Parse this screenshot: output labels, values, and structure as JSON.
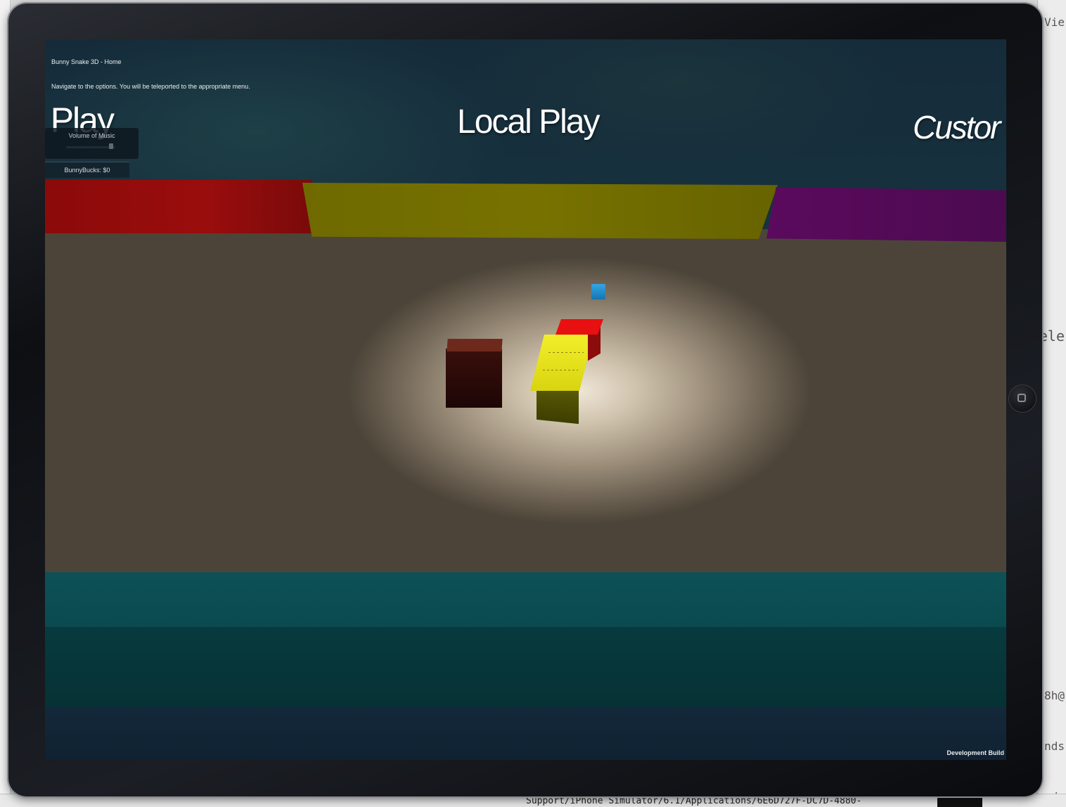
{
  "game": {
    "hud_title": "Bunny Snake 3D - Home",
    "hud_subtitle": "Navigate to the options. You will be teleported to the appropriate menu.",
    "menu": {
      "left_label": "e Play",
      "center_label": "Local Play",
      "right_label": "Custor"
    },
    "volume": {
      "label": "Volume of Music",
      "value": 0.95
    },
    "bunnybucks_label": "BunnyBucks: $0",
    "build_label": "Development Build"
  },
  "background_window": {
    "right_fragments": [
      "Vie",
      "ele",
      "8h@",
      "nds",
      "ands"
    ],
    "bottom_path": "Support/iPhone Simulator/6.1/Applications/6E6D727F-DC7D-4880-"
  },
  "colors": {
    "wall_red": "#8c0a0a",
    "wall_yellow": "#777200",
    "wall_purple": "#5b0a5d",
    "wall_teal": "#0d5156",
    "snake_head": "#e81010",
    "snake_body": "#f2ee2a",
    "food": "#33a6e6",
    "obstacle": "#3a0f0b"
  }
}
